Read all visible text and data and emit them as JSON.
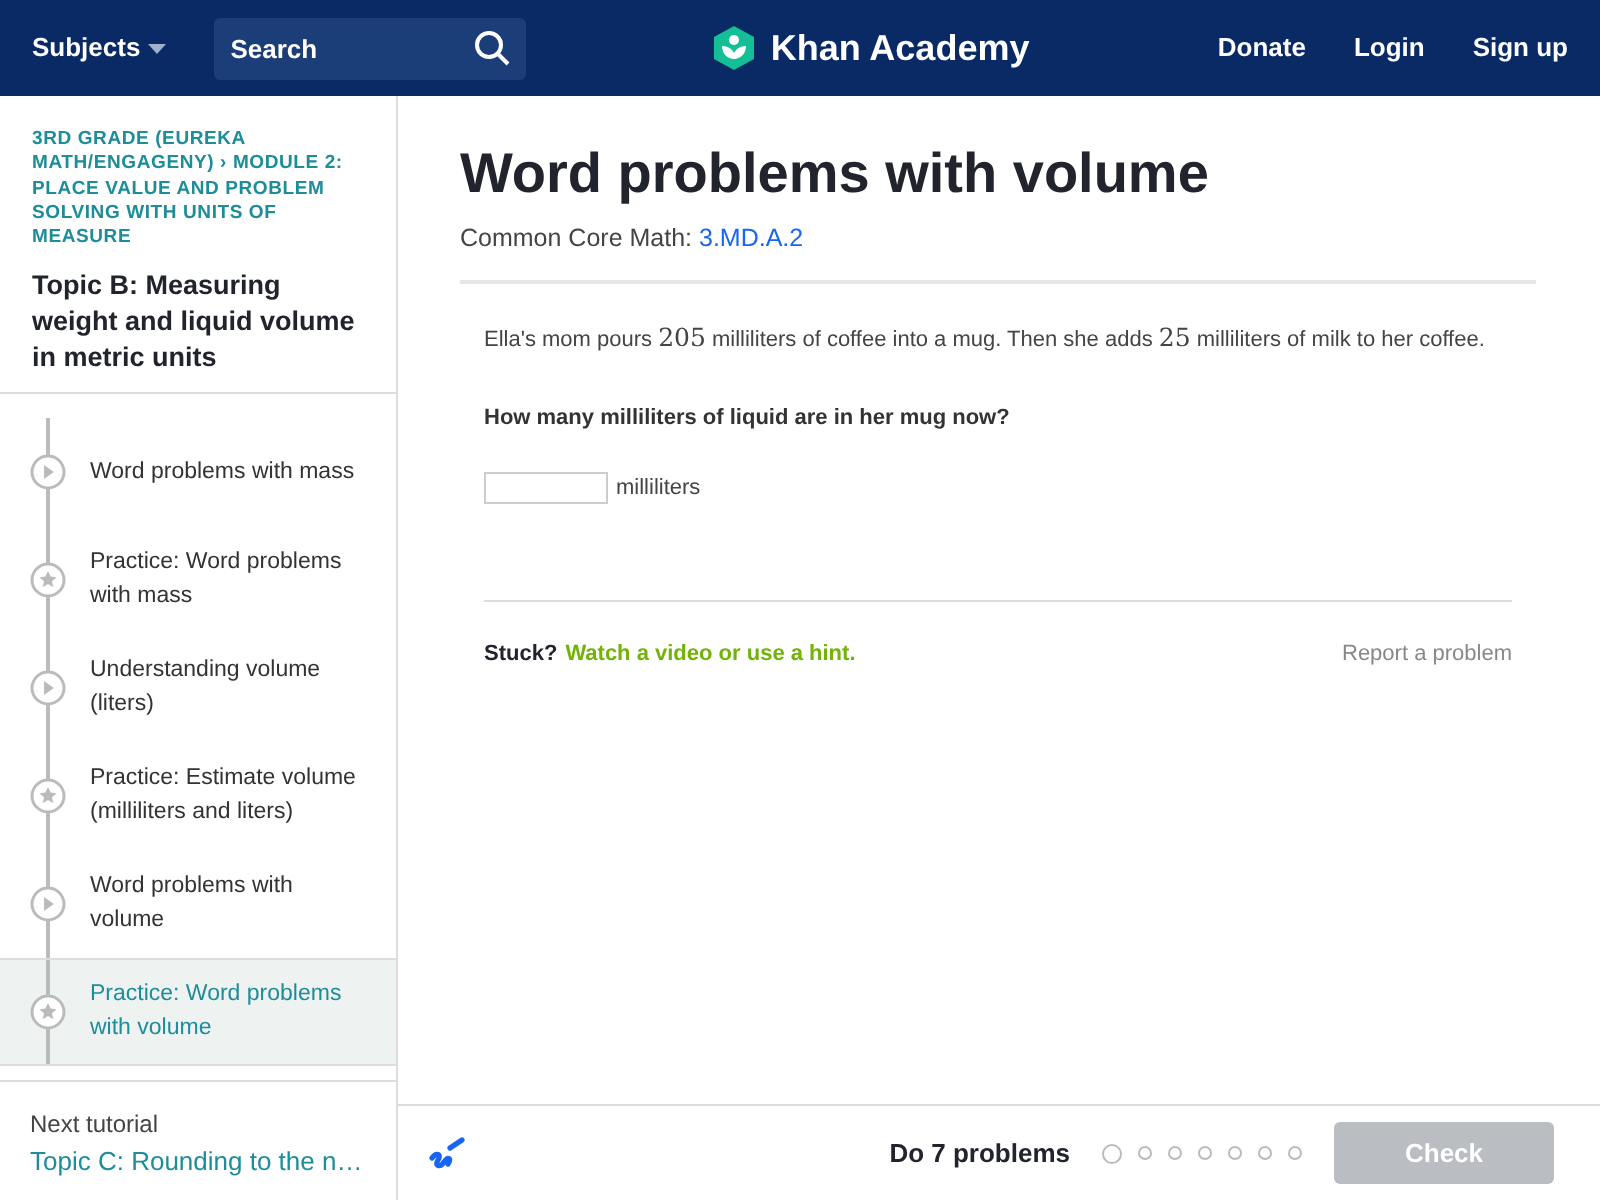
{
  "header": {
    "subjects": "Subjects",
    "search": {
      "placeholder": "Search"
    },
    "logo": "Khan Academy",
    "links": [
      "Donate",
      "Login",
      "Sign up"
    ]
  },
  "sidebar": {
    "breadcrumb": "3RD GRADE (EUREKA MATH/ENGAGENY) › MODULE 2: PLACE VALUE AND PROBLEM SOLVING WITH UNITS OF MEASURE",
    "topic": "Topic B: Measuring weight and liquid volume in metric units",
    "items": [
      {
        "kind": "video",
        "label": "Word problems with mass",
        "selected": false
      },
      {
        "kind": "practice",
        "label": "Practice: Word problems with mass",
        "selected": false
      },
      {
        "kind": "video",
        "label": "Understanding volume (liters)",
        "selected": false
      },
      {
        "kind": "practice",
        "label": "Practice: Estimate volume (milliliters and liters)",
        "selected": false
      },
      {
        "kind": "video",
        "label": "Word problems with volume",
        "selected": false
      },
      {
        "kind": "practice",
        "label": "Practice: Word problems with volume",
        "selected": true
      }
    ],
    "next_label": "Next tutorial",
    "next_title": "Topic C: Rounding to the n…"
  },
  "main": {
    "title": "Word problems with volume",
    "standard_label": "Common Core Math:",
    "standard_link": "3.MD.A.2",
    "problem": [
      {
        "kind": "text",
        "text": "Ella's mom pours "
      },
      {
        "kind": "math",
        "text": "205"
      },
      {
        "kind": "text",
        "text": " milliliters of coffee into a mug. Then she adds "
      },
      {
        "kind": "math",
        "text": "25"
      },
      {
        "kind": "text",
        "text": " milliliters of milk to her coffee."
      }
    ],
    "question": "How many milliliters of liquid are in her mug now?",
    "answer": {
      "unit": "milliliters"
    },
    "stuck": "Stuck?",
    "hint_link": "Watch a video or use a hint.",
    "report": "Report a problem"
  },
  "footer": {
    "goal": "Do 7 problems",
    "problems": [
      {
        "selected": true
      },
      {
        "selected": false
      },
      {
        "selected": false
      },
      {
        "selected": false
      },
      {
        "selected": false
      },
      {
        "selected": false
      },
      {
        "selected": false
      }
    ],
    "check": {
      "label": "Check",
      "disabled": true
    }
  }
}
